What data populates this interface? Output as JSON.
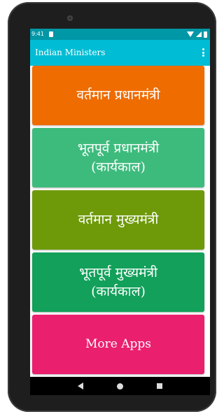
{
  "statusbar": {
    "time": "9:41"
  },
  "appbar": {
    "title": "Indian Ministers"
  },
  "menu": [
    {
      "label": "वर्तमान प्रधानमंत्री",
      "color": "#ef6c00"
    },
    {
      "label": "भूतपूर्व प्रधानमंत्री\n(कार्यकाल)",
      "color": "#3dbb7d"
    },
    {
      "label": "वर्तमान मुख्यमंत्री",
      "color": "#6e9a0a"
    },
    {
      "label": "भूतपूर्व मुख्यमंत्री\n(कार्यकाल)",
      "color": "#12a05a"
    },
    {
      "label": "More Apps",
      "color": "#ea1f6e"
    }
  ],
  "colors": {
    "statusbar": "#0097a7",
    "appbar": "#00bcd4"
  },
  "icons": [
    "camera-icon",
    "sim-icon",
    "wifi-icon",
    "signal-icon",
    "battery-icon",
    "more-vert-icon",
    "back-icon",
    "home-icon",
    "recents-icon"
  ]
}
